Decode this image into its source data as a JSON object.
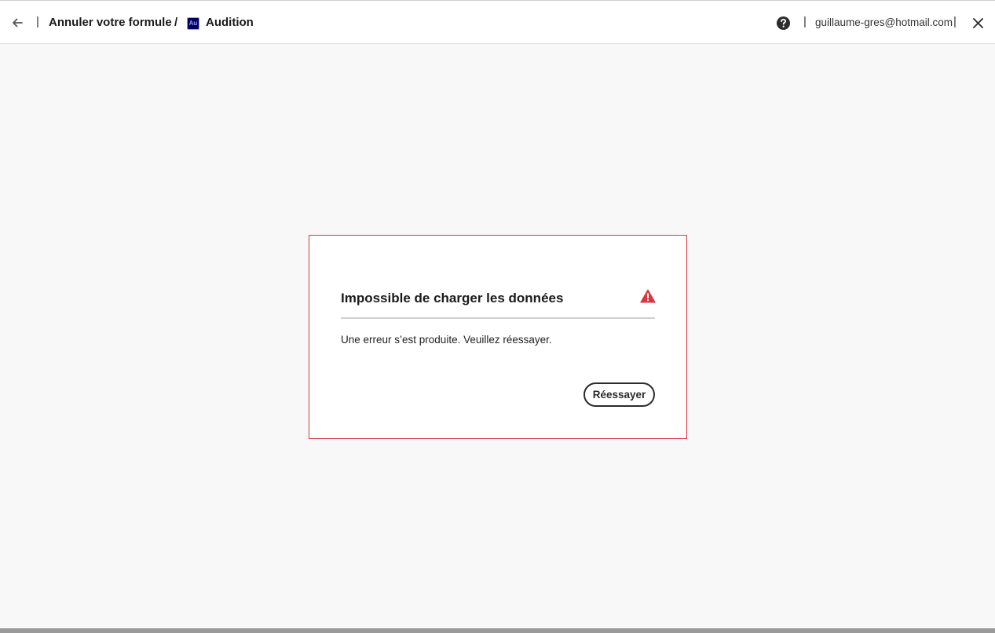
{
  "header": {
    "back_icon": "arrow-left-icon",
    "separator": "|",
    "breadcrumb_cancel": "Annuler votre formule",
    "breadcrumb_slash": "/",
    "app_logo_text": "Au",
    "app_logo_color": "#00005b",
    "app_name": "Audition",
    "help_icon": "question-circle-icon",
    "user_email": "guillaume-gres@hotmail.com",
    "close_icon": "close-icon"
  },
  "dialog": {
    "title": "Impossible de charger les données",
    "warning_icon": "alert-triangle-icon",
    "message": "Une erreur s’est produite. Veuillez réessayer.",
    "retry_label": "Réessayer",
    "border_color": "#d7373f",
    "warning_color": "#d7373f"
  }
}
